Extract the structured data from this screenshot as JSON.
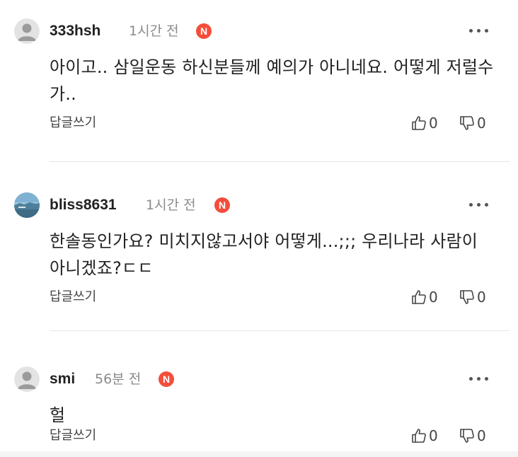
{
  "comments": [
    {
      "username": "333hsh",
      "time": "1시간 전",
      "badge": "N",
      "text": "아이고.. 삼일운동 하신분들께 예의가 아니네요. 어떻게 저럴수가..",
      "reply_label": "답글쓰기",
      "likes": "0",
      "dislikes": "0",
      "avatar": "default-person-icon"
    },
    {
      "username": "bliss8631",
      "time": "1시간 전",
      "badge": "N",
      "text": "한솔동인가요? 미치지않고서야 어떻게...;;; 우리나라 사람이 아니겠죠?ㄷㄷ",
      "reply_label": "답글쓰기",
      "likes": "0",
      "dislikes": "0",
      "avatar": "landscape-photo"
    },
    {
      "username": "smi",
      "time": "56분 전",
      "badge": "N",
      "text": "헐",
      "reply_label": "답글쓰기",
      "likes": "0",
      "dislikes": "0",
      "avatar": "default-person-icon"
    }
  ],
  "colors": {
    "badge": "#f44d3a",
    "time": "#8a8a8a",
    "text": "#222222",
    "divider": "#e6e6e6"
  },
  "icons": {
    "more": "more-dots-icon",
    "like": "thumbs-up-icon",
    "dislike": "thumbs-down-icon"
  }
}
